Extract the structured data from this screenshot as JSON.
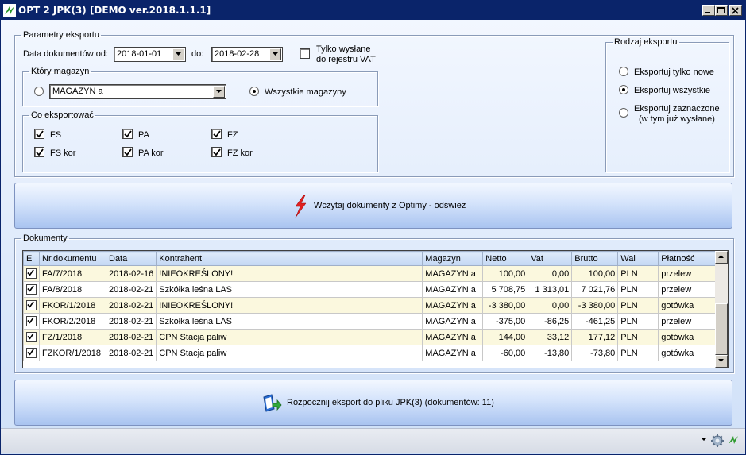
{
  "window": {
    "title": "OPT 2 JPK(3) [DEMO ver.2018.1.1.1]"
  },
  "params": {
    "legend": "Parametry eksportu",
    "date_from_label": "Data dokumentów od:",
    "date_from": "2018-01-01",
    "date_to_label": "do:",
    "date_to": "2018-02-28",
    "only_sent_line1": "Tylko wysłane",
    "only_sent_line2": "do rejestru VAT",
    "only_sent_checked": false,
    "warehouse": {
      "legend": "Który magazyn",
      "selected": "MAGAZYN a",
      "all_label": "Wszystkie magazyny",
      "mode": "all"
    },
    "what": {
      "legend": "Co eksportować",
      "items": [
        {
          "label": "FS",
          "checked": true
        },
        {
          "label": "PA",
          "checked": true
        },
        {
          "label": "FZ",
          "checked": true
        },
        {
          "label": "FS kor",
          "checked": true
        },
        {
          "label": "PA kor",
          "checked": true
        },
        {
          "label": "FZ kor",
          "checked": true
        }
      ]
    }
  },
  "export_type": {
    "legend": "Rodzaj eksportu",
    "options": [
      {
        "label": "Eksportuj tylko nowe",
        "selected": false
      },
      {
        "label": "Eksportuj wszystkie",
        "selected": true
      },
      {
        "label": "Eksportuj zaznaczone",
        "label2": "(w tym już wysłane)",
        "selected": false
      }
    ]
  },
  "load_button": {
    "label": "Wczytaj dokumenty z Optimy - odśwież"
  },
  "documents": {
    "legend": "Dokumenty",
    "columns": [
      "E",
      "Nr.dokumentu",
      "Data",
      "Kontrahent",
      "Magazyn",
      "Netto",
      "Vat",
      "Brutto",
      "Wal",
      "Płatność"
    ],
    "rows": [
      {
        "checked": true,
        "nr": "FA/7/2018",
        "date": "2018-02-16",
        "contractor": "!NIEOKREŚLONY!",
        "warehouse": "MAGAZYN a",
        "net": "100,00",
        "vat": "0,00",
        "gross": "100,00",
        "cur": "PLN",
        "payment": "przelew"
      },
      {
        "checked": true,
        "nr": "FA/8/2018",
        "date": "2018-02-21",
        "contractor": "Szkółka leśna LAS",
        "warehouse": "MAGAZYN a",
        "net": "5 708,75",
        "vat": "1 313,01",
        "gross": "7 021,76",
        "cur": "PLN",
        "payment": "przelew"
      },
      {
        "checked": true,
        "nr": "FKOR/1/2018",
        "date": "2018-02-21",
        "contractor": "!NIEOKREŚLONY!",
        "warehouse": "MAGAZYN a",
        "net": "-3 380,00",
        "vat": "0,00",
        "gross": "-3 380,00",
        "cur": "PLN",
        "payment": "gotówka"
      },
      {
        "checked": true,
        "nr": "FKOR/2/2018",
        "date": "2018-02-21",
        "contractor": "Szkółka leśna LAS",
        "warehouse": "MAGAZYN a",
        "net": "-375,00",
        "vat": "-86,25",
        "gross": "-461,25",
        "cur": "PLN",
        "payment": "przelew"
      },
      {
        "checked": true,
        "nr": "FZ/1/2018",
        "date": "2018-02-21",
        "contractor": "CPN Stacja paliw",
        "warehouse": "MAGAZYN a",
        "net": "144,00",
        "vat": "33,12",
        "gross": "177,12",
        "cur": "PLN",
        "payment": "gotówka"
      },
      {
        "checked": true,
        "nr": "FZKOR/1/2018",
        "date": "2018-02-21",
        "contractor": "CPN Stacja paliw",
        "warehouse": "MAGAZYN a",
        "net": "-60,00",
        "vat": "-13,80",
        "gross": "-73,80",
        "cur": "PLN",
        "payment": "gotówka"
      }
    ]
  },
  "export_button": {
    "label": "Rozpocznij eksport do pliku JPK(3) (dokumentów: 11)"
  },
  "colors": {
    "title_bar": "#0a246a",
    "row_highlight": "#fbf8de",
    "bolt": "#e02020"
  }
}
